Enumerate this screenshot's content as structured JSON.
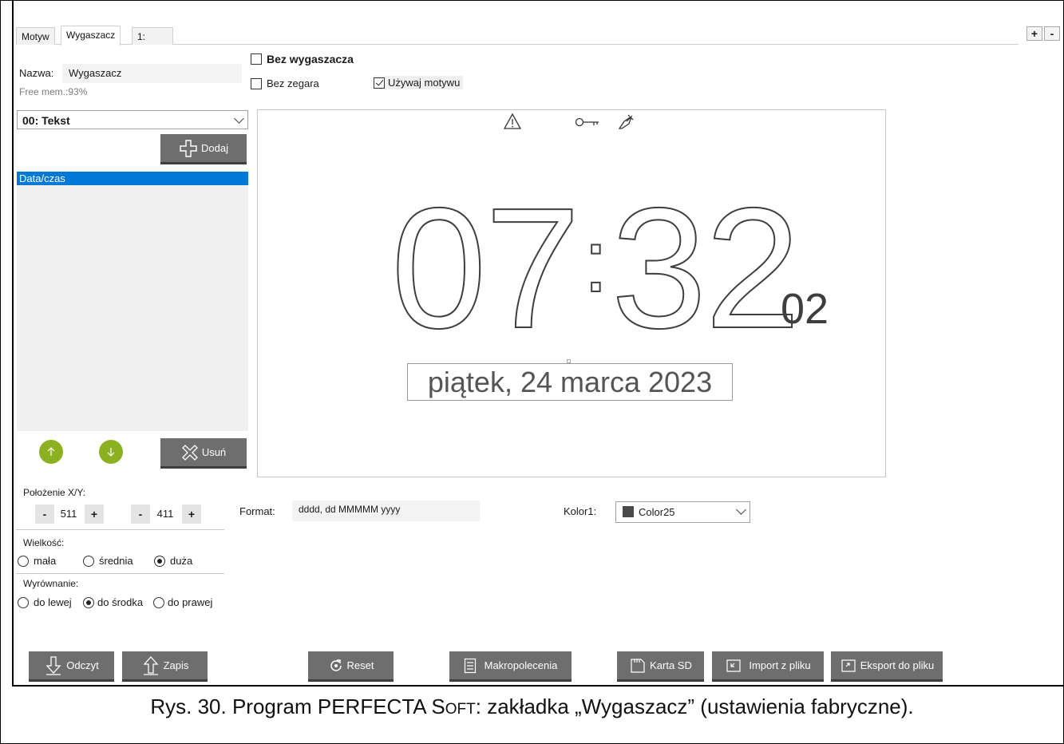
{
  "tabs": [
    "Motyw",
    "Wygaszacz",
    "1:"
  ],
  "zoom": {
    "plus": "+",
    "minus": "-"
  },
  "name": {
    "label": "Nazwa:",
    "value": "Wygaszacz"
  },
  "free_mem": "Free mem.:93%",
  "element_type": "00: Tekst",
  "add_button": "Dodaj",
  "elements_list": [
    "Data/czas"
  ],
  "remove_button": "Usuń",
  "position": {
    "label": "Położenie X/Y:",
    "x": "511",
    "y": "411",
    "minus": "-",
    "plus": "+"
  },
  "size": {
    "label": "Wielkość:",
    "options": [
      "mała",
      "średnia",
      "duża"
    ],
    "selected": "duża"
  },
  "alignment": {
    "label": "Wyrównanie:",
    "options": [
      "do lewej",
      "do środka",
      "do prawej"
    ],
    "selected": "do środka"
  },
  "options": {
    "no_screensaver": {
      "label": "Bez wygaszacza",
      "checked": false
    },
    "no_clock": {
      "label": "Bez zegara",
      "checked": false
    },
    "use_theme": {
      "label": "Używaj motywu",
      "checked": true
    }
  },
  "preview": {
    "time_hm": "07",
    "time_m": "32",
    "seconds": "02",
    "date": "piątek, 24 marca 2023",
    "icons": [
      "warning-icon",
      "key-icon",
      "satellite-icon"
    ]
  },
  "format": {
    "label": "Format:",
    "value": "dddd, dd MMMMM yyyy"
  },
  "color": {
    "label": "Kolor1:",
    "value": "Color25",
    "swatch": "#4a4a4a"
  },
  "bottom_buttons": [
    "Odczyt",
    "Zapis",
    "Reset",
    "Makropolecenia",
    "Karta SD",
    "Import z pliku",
    "Eksport do pliku"
  ],
  "caption": {
    "prefix": "Rys. 30. Program PERFECTA S",
    "small_caps": "OFT",
    "suffix": ": zakładka „Wygaszacz” (ustawienia fabryczne)."
  },
  "colors": {
    "accent_green": "#8bb020",
    "selection_blue": "#0078d7",
    "button_gray": "#6e6e6e"
  }
}
